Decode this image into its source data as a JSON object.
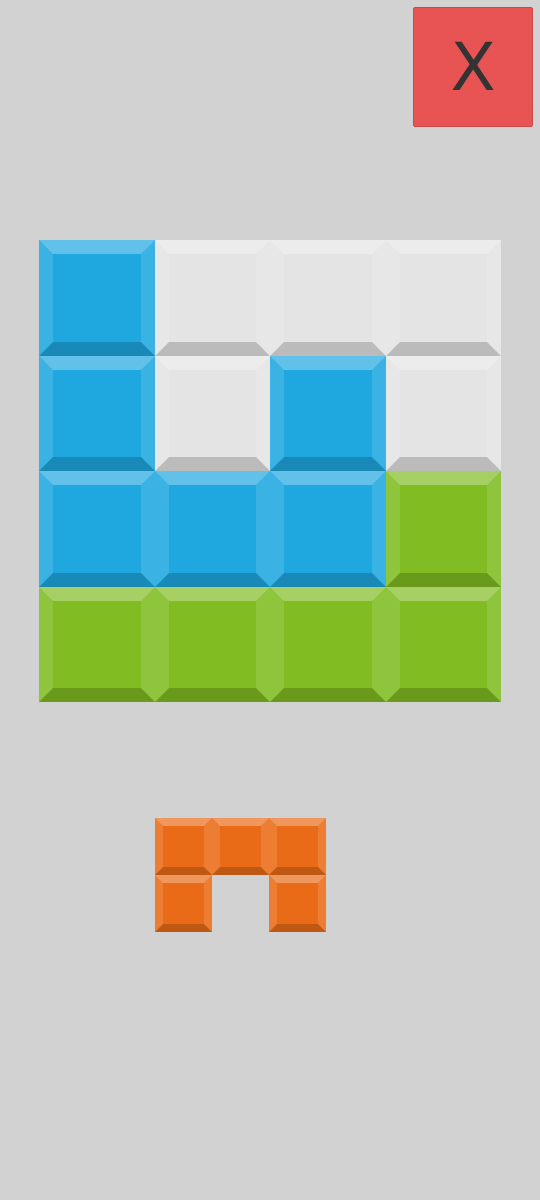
{
  "close_button": {
    "label": "X"
  },
  "board": {
    "rows": [
      [
        {
          "color": "#1fa7e0"
        },
        {
          "color": "#e4e4e4"
        },
        {
          "color": "#e4e4e4"
        },
        {
          "color": "#e4e4e4"
        }
      ],
      [
        {
          "color": "#1fa7e0"
        },
        {
          "color": "#e4e4e4"
        },
        {
          "color": "#1fa7e0"
        },
        {
          "color": "#e4e4e4"
        }
      ],
      [
        {
          "color": "#1fa7e0"
        },
        {
          "color": "#1fa7e0"
        },
        {
          "color": "#1fa7e0"
        },
        {
          "color": "#80bc22"
        }
      ],
      [
        {
          "color": "#80bc22"
        },
        {
          "color": "#80bc22"
        },
        {
          "color": "#80bc22"
        },
        {
          "color": "#80bc22"
        }
      ]
    ]
  },
  "piece": {
    "color": "#e96b17",
    "rows": [
      [
        {
          "filled": true
        },
        {
          "filled": true
        },
        {
          "filled": true
        }
      ],
      [
        {
          "filled": true
        },
        {
          "filled": false
        },
        {
          "filled": true
        }
      ]
    ]
  }
}
